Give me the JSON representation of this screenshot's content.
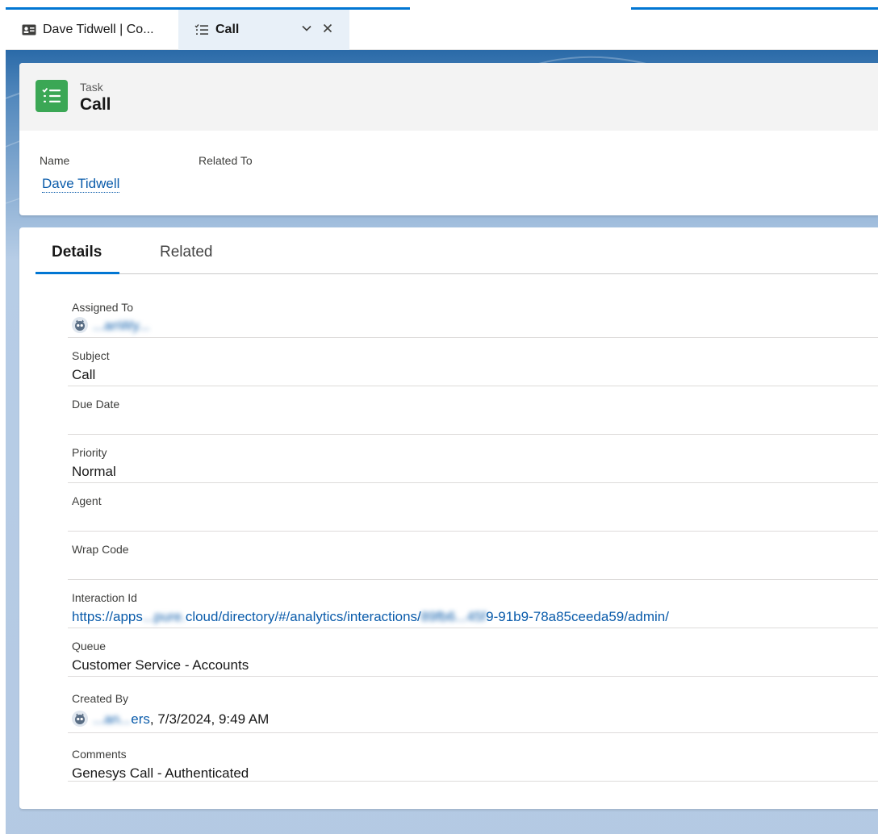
{
  "colors": {
    "brand_blue": "#0176d3",
    "link": "#0b5cab",
    "task_icon_green": "#3ba755",
    "page_background": "#b4c9e3"
  },
  "workspace_tabs": [
    {
      "label": "Dave Tidwell | Co...",
      "icon": "contact-card-icon"
    },
    {
      "label": "Call",
      "icon": "task-list-icon"
    }
  ],
  "record": {
    "object_type": "Task",
    "title": "Call",
    "highlights": {
      "name_label": "Name",
      "name_value": "Dave Tidwell",
      "related_label": "Related To",
      "related_value": ""
    }
  },
  "detail_tabs": [
    "Details",
    "Related"
  ],
  "fields": {
    "assigned_to": {
      "label": "Assigned To",
      "value": "...anWy..."
    },
    "subject": {
      "label": "Subject",
      "value": "Call"
    },
    "due_date": {
      "label": "Due Date",
      "value": ""
    },
    "priority": {
      "label": "Priority",
      "value": "Normal"
    },
    "agent": {
      "label": "Agent",
      "value": ""
    },
    "wrap_code": {
      "label": "Wrap Code",
      "value": ""
    },
    "interaction_id": {
      "label": "Interaction Id",
      "value_start": "https://apps",
      "value_redacted_1": "...pure.",
      "value_mid": "cloud/directory/#/analytics/interactions/",
      "value_redacted_2": "89fb6...45f",
      "value_end": "9-91b9-78a85ceeda59/admin/"
    },
    "queue": {
      "label": "Queue",
      "value": "Customer Service - Accounts"
    },
    "created_by": {
      "label": "Created By",
      "user_redacted": "...an...",
      "user_visible": "ers",
      "timestamp": ", 7/3/2024, 9:49 AM"
    },
    "comments": {
      "label": "Comments",
      "value": "Genesys Call - Authenticated"
    }
  }
}
